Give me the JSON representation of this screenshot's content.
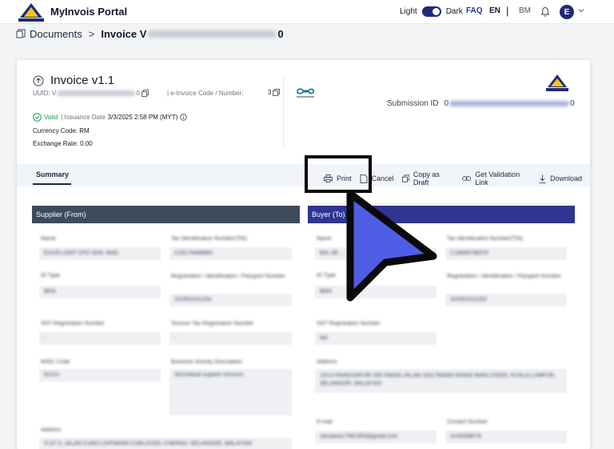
{
  "header": {
    "portal_title": "MyInvois Portal",
    "theme_light": "Light",
    "theme_dark": "Dark",
    "faq": "FAQ",
    "lang_en": "EN",
    "lang_sep": "|",
    "lang_bm": "BM",
    "avatar_initial": "E"
  },
  "breadcrumb": {
    "documents": "Documents",
    "sep": ">",
    "invoice_prefix": "Invoice V",
    "invoice_suffix": "0"
  },
  "invoice": {
    "title": "Invoice v1.1",
    "uuid_label": "UUID: V",
    "uuid_suffix": "0",
    "code_label": "| e-Invoice Code / Number:",
    "code_suffix": "3",
    "valid": "Valid",
    "issuance_label": "| Issuance Date",
    "issuance_date": "3/3/2025 2:58 PM (MYT)",
    "currency": "Currency Code: RM",
    "exchange_rate": "Exchange Rate: 0.00",
    "submission_label": "Submission ID",
    "submission_prefix": "0",
    "submission_suffix": "0"
  },
  "tabs": {
    "summary": "Summary"
  },
  "actions": {
    "print": "Print",
    "cancel": "Cancel",
    "copy_draft": "Copy as Draft",
    "validation_link": "Get Validation Link",
    "download": "Download"
  },
  "supplier": {
    "heading": "Supplier (From)",
    "fields": [
      {
        "label": "Name",
        "value": "EXCELLENT CFO SDN. BHD."
      },
      {
        "label": "Tax Identification Number(TIN)",
        "value": "C26178488800"
      },
      {
        "label": "ID Type",
        "value": "BRN"
      },
      {
        "label": "Registration / Identification / Passport Number",
        "value": "201801041164"
      },
      {
        "label": "SST Registration Number",
        "value": "-"
      },
      {
        "label": "Tourism Tax Registration Number",
        "value": "-"
      },
      {
        "label": "MSIC Code",
        "value": "82110"
      },
      {
        "label": "Business Activity Description",
        "value": "Secretarial support services"
      },
      {
        "label": "Address",
        "value": "D-37-3, JALAN C180/1,DATARAN C180,42200, CHERAS, SELANGOR, MALAYSIA"
      }
    ]
  },
  "buyer": {
    "heading": "Buyer (To)",
    "fields": [
      {
        "label": "Name",
        "value": "BAI JIE ..."
      },
      {
        "label": "Tax Identification Number(TIN)",
        "value": "C18608798070"
      },
      {
        "label": "ID Type",
        "value": "BRN"
      },
      {
        "label": "Registration / Identification / Passport Number",
        "value": "202401011262"
      },
      {
        "label": "SST Registration Number",
        "value": "NA"
      },
      {
        "label": "Address",
        "value": "10/14 PANGSAPURI SRI INANG,JALAN 16/3,TAMAN INANG BARU,52000, KUALA LUMPUR, SELANGOR, MALAYSIA"
      },
      {
        "label": "E-mail",
        "value": "sienaiwa17961993@gmail.com"
      },
      {
        "label": "Contact Number",
        "value": "0143289076"
      }
    ]
  }
}
